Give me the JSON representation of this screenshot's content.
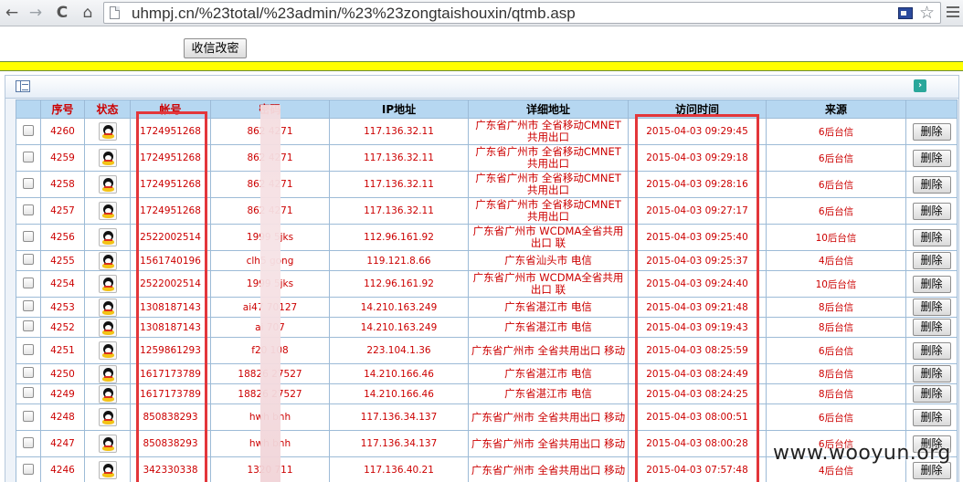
{
  "browser": {
    "url": "uhmpj.cn/%23total/%23admin/%23%23zongtaishouxin/qtmb.asp",
    "back_glyph": "←",
    "forward_glyph": "→",
    "reload_glyph": "C",
    "home_glyph": "⌂",
    "star_glyph": "☆"
  },
  "page": {
    "modify_button": "收信改密",
    "bar_color": "#ffff00"
  },
  "panel": {
    "expand_glyph": "›"
  },
  "table": {
    "headers": [
      "序号",
      "状态",
      "帐号",
      "密码",
      "IP地址",
      "详细地址",
      "访问时间",
      "来源"
    ],
    "delete_label": "删除",
    "rows": [
      {
        "id": "4260",
        "account": "1724951268",
        "password": "862   4271",
        "ip": "117.136.32.11",
        "address": "广东省广州市 全省移动CMNET共用出口",
        "time": "2015-04-03 09:29:45",
        "source": "6后台信"
      },
      {
        "id": "4259",
        "account": "1724951268",
        "password": "862   4271",
        "ip": "117.136.32.11",
        "address": "广东省广州市 全省移动CMNET共用出口",
        "time": "2015-04-03 09:29:18",
        "source": "6后台信"
      },
      {
        "id": "4258",
        "account": "1724951268",
        "password": "862   4271",
        "ip": "117.136.32.11",
        "address": "广东省广州市 全省移动CMNET共用出口",
        "time": "2015-04-03 09:28:16",
        "source": "6后台信"
      },
      {
        "id": "4257",
        "account": "1724951268",
        "password": "862   4271",
        "ip": "117.136.32.11",
        "address": "广东省广州市 全省移动CMNET共用出口",
        "time": "2015-04-03 09:27:17",
        "source": "6后台信"
      },
      {
        "id": "4256",
        "account": "2522002514",
        "password": "1999   5jks",
        "ip": "112.96.161.92",
        "address": "广东省广州市 WCDMA全省共用出口 联",
        "time": "2015-04-03 09:25:40",
        "source": "10后台信"
      },
      {
        "id": "4255",
        "account": "1561740196",
        "password": "clh5   gong",
        "ip": "119.121.8.66",
        "address": "广东省汕头市 电信",
        "time": "2015-04-03 09:25:37",
        "source": "4后台信"
      },
      {
        "id": "4254",
        "account": "2522002514",
        "password": "1999   5jks",
        "ip": "112.96.161.92",
        "address": "广东省广州市 WCDMA全省共用出口 联",
        "time": "2015-04-03 09:24:40",
        "source": "10后台信"
      },
      {
        "id": "4253",
        "account": "1308187143",
        "password": "ai47   70127",
        "ip": "14.210.163.249",
        "address": "广东省湛江市 电信",
        "time": "2015-04-03 09:21:48",
        "source": "8后台信"
      },
      {
        "id": "4252",
        "account": "1308187143",
        "password": "ai   707",
        "ip": "14.210.163.249",
        "address": "广东省湛江市 电信",
        "time": "2015-04-03 09:19:43",
        "source": "8后台信"
      },
      {
        "id": "4251",
        "account": "1259861293",
        "password": "f20   108",
        "ip": "223.104.1.36",
        "address": "广东省广州市 全省共用出口 移动",
        "time": "2015-04-03 08:25:59",
        "source": "6后台信"
      },
      {
        "id": "4250",
        "account": "1617173789",
        "password": "18826   27527",
        "ip": "14.210.166.46",
        "address": "广东省湛江市 电信",
        "time": "2015-04-03 08:24:49",
        "source": "8后台信"
      },
      {
        "id": "4249",
        "account": "1617173789",
        "password": "18826   27527",
        "ip": "14.210.166.46",
        "address": "广东省湛江市 电信",
        "time": "2015-04-03 08:24:25",
        "source": "8后台信"
      },
      {
        "id": "4248",
        "account": "850838293",
        "password": "hwh   bnh",
        "ip": "117.136.34.137",
        "address": "广东省广州市 全省共用出口 移动",
        "time": "2015-04-03 08:00:51",
        "source": "6后台信"
      },
      {
        "id": "4247",
        "account": "850838293",
        "password": "hwh   bnh",
        "ip": "117.136.34.137",
        "address": "广东省广州市 全省共用出口 移动",
        "time": "2015-04-03 08:00:28",
        "source": "6后台信"
      },
      {
        "id": "4246",
        "account": "342330338",
        "password": "1320   711",
        "ip": "117.136.40.21",
        "address": "广东省广州市 全省共用出口 移动",
        "time": "2015-04-03 07:57:48",
        "source": "4后台信"
      }
    ]
  },
  "watermark": "www.wooyun.org",
  "colors": {
    "header_bg": "#b6d7f1",
    "text_red": "#cc0000",
    "highlight_box": "#e3363a"
  }
}
